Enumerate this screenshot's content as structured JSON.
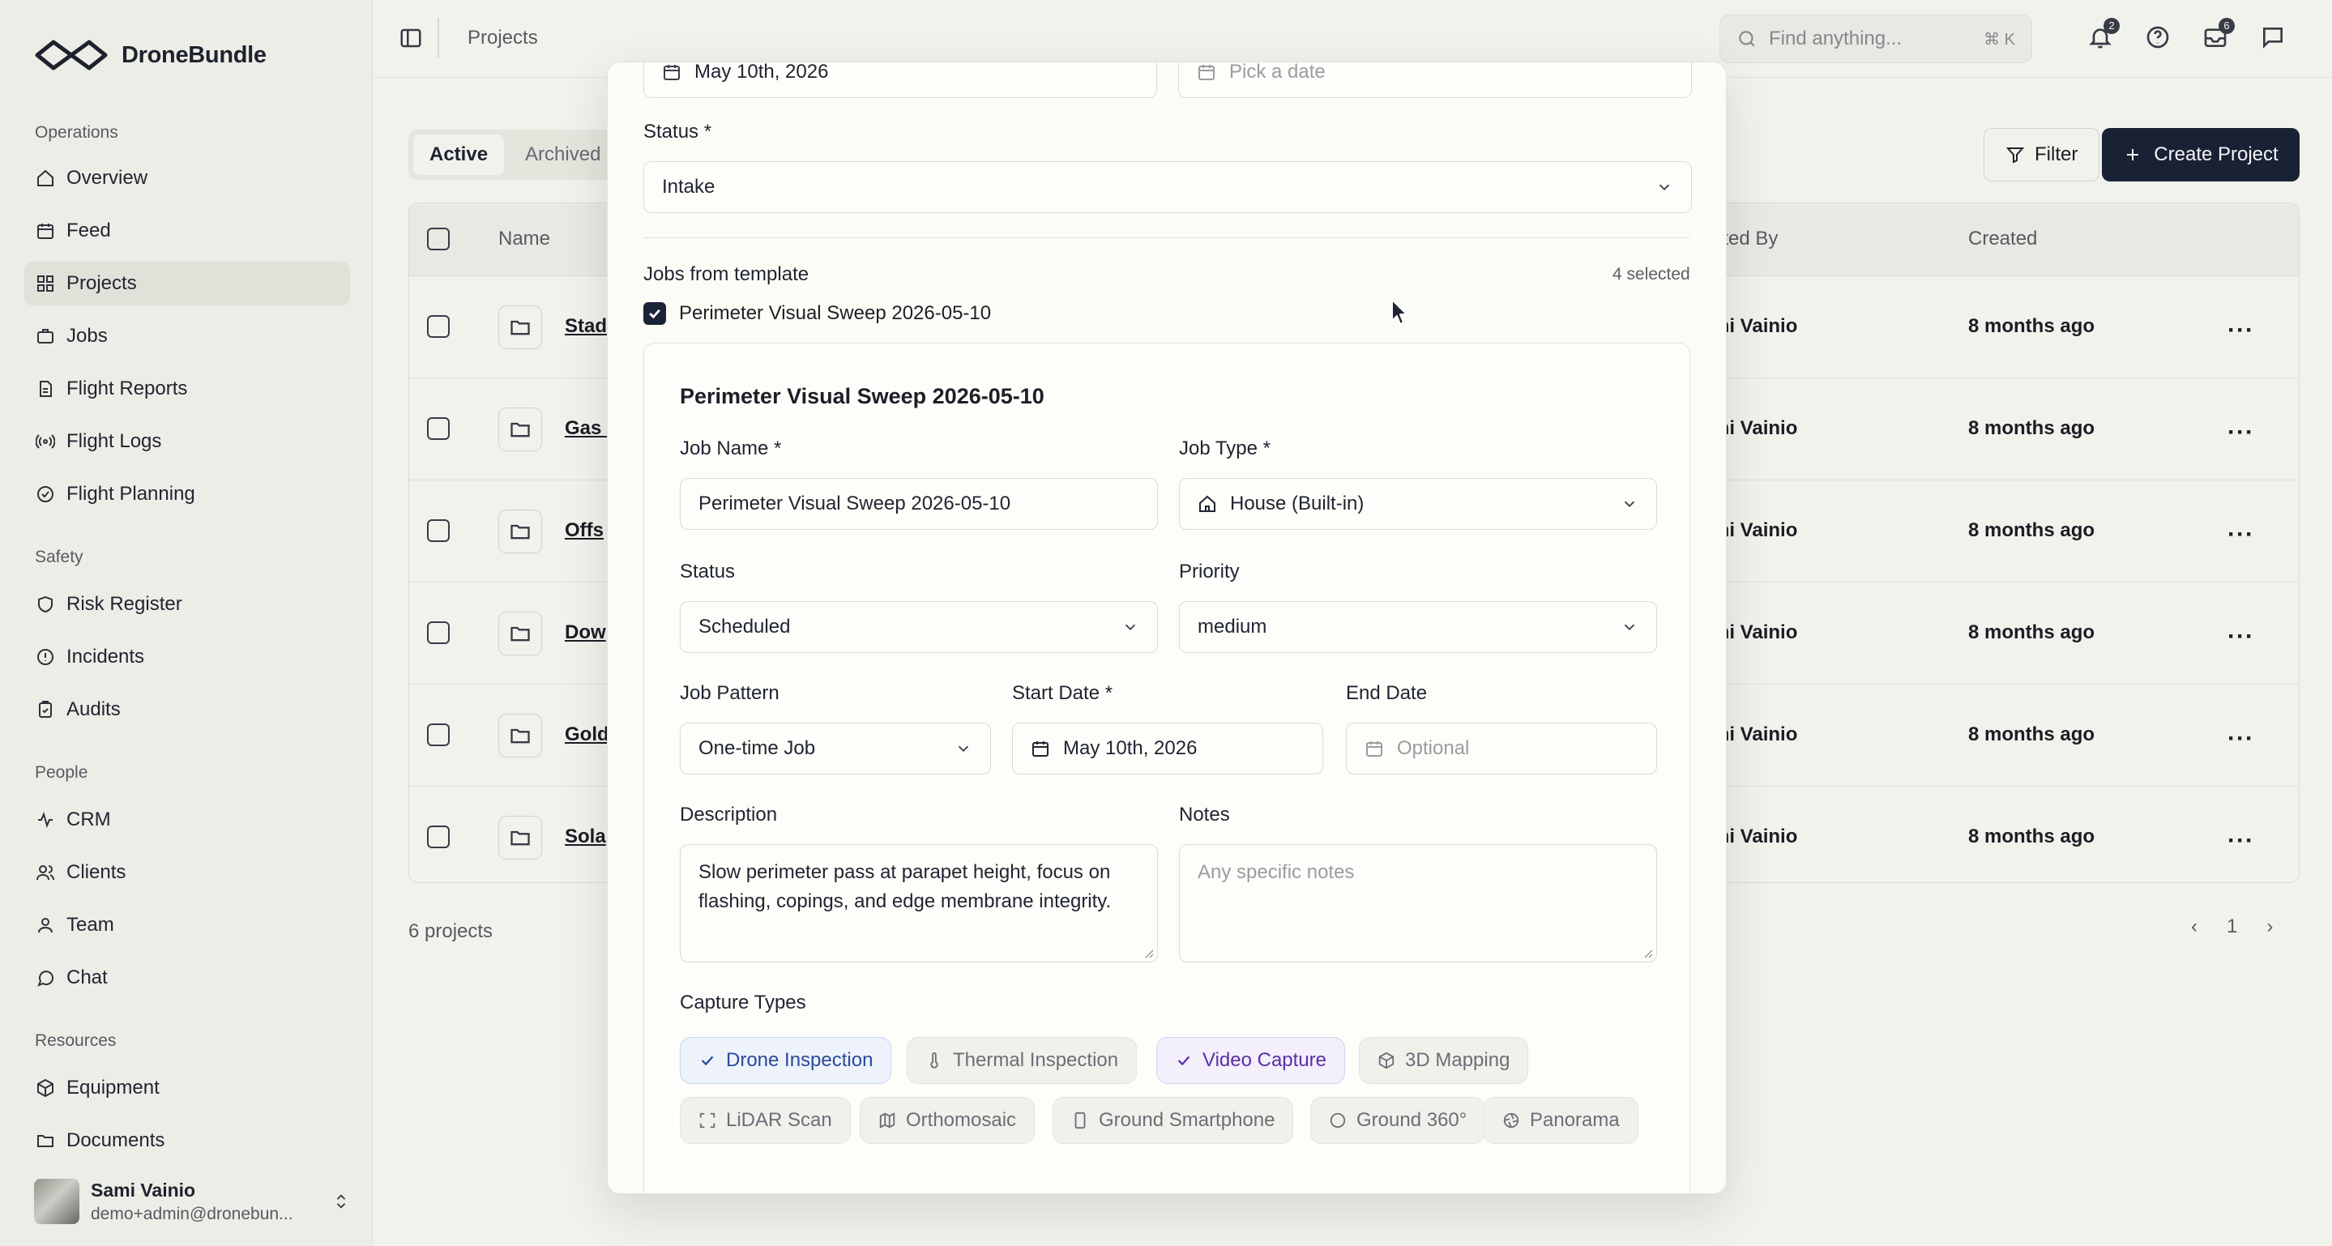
{
  "app": {
    "name": "DroneBundle"
  },
  "sidebar": {
    "sections": [
      {
        "title": "Operations",
        "items": [
          {
            "label": "Overview",
            "icon": "home-icon"
          },
          {
            "label": "Feed",
            "icon": "calendar-icon"
          },
          {
            "label": "Projects",
            "icon": "grid-icon",
            "active": true
          },
          {
            "label": "Jobs",
            "icon": "briefcase-icon"
          },
          {
            "label": "Flight Reports",
            "icon": "file-icon"
          },
          {
            "label": "Flight Logs",
            "icon": "radio-icon"
          },
          {
            "label": "Flight Planning",
            "icon": "check-circle-icon"
          }
        ]
      },
      {
        "title": "Safety",
        "items": [
          {
            "label": "Risk Register",
            "icon": "shield-icon"
          },
          {
            "label": "Incidents",
            "icon": "alert-icon"
          },
          {
            "label": "Audits",
            "icon": "clipboard-icon"
          }
        ]
      },
      {
        "title": "People",
        "items": [
          {
            "label": "CRM",
            "icon": "activity-icon"
          },
          {
            "label": "Clients",
            "icon": "users-icon"
          },
          {
            "label": "Team",
            "icon": "team-icon"
          },
          {
            "label": "Chat",
            "icon": "chat-icon"
          }
        ]
      },
      {
        "title": "Resources",
        "items": [
          {
            "label": "Equipment",
            "icon": "box-icon"
          },
          {
            "label": "Documents",
            "icon": "folder-icon"
          }
        ]
      }
    ],
    "user": {
      "name": "Sami Vainio",
      "email": "demo+admin@dronebun..."
    }
  },
  "topbar": {
    "breadcrumb": "Projects",
    "search_placeholder": "Find anything...",
    "search_shortcut": "⌘ K",
    "notifications_badge": "2",
    "messages_badge": "6"
  },
  "page": {
    "tabs": [
      "Active",
      "Archived"
    ],
    "filter_label": "Filter",
    "create_label": "Create Project",
    "columns": {
      "name": "Name",
      "created_by": "ated By",
      "created": "Created"
    },
    "rows": [
      {
        "name": "Stad",
        "by": "mi Vainio",
        "created": "8 months ago"
      },
      {
        "name": "Gas I",
        "by": "mi Vainio",
        "created": "8 months ago"
      },
      {
        "name": "Offs",
        "by": "mi Vainio",
        "created": "8 months ago"
      },
      {
        "name": "Dow",
        "by": "mi Vainio",
        "created": "8 months ago"
      },
      {
        "name": "Gold",
        "by": "mi Vainio",
        "created": "8 months ago"
      },
      {
        "name": "Sola",
        "by": "mi Vainio",
        "created": "8 months ago"
      }
    ],
    "count": "6 projects",
    "page_number": "1"
  },
  "modal": {
    "start_date": "May 10th, 2026",
    "end_date_placeholder": "Pick a date",
    "status_label": "Status *",
    "status_value": "Intake",
    "jobs_label": "Jobs from template",
    "jobs_selected": "4 selected",
    "job_checkbox_label": "Perimeter Visual Sweep 2026-05-10",
    "job": {
      "title": "Perimeter Visual Sweep 2026-05-10",
      "name_label": "Job Name *",
      "name_value": "Perimeter Visual Sweep 2026-05-10",
      "type_label": "Job Type *",
      "type_value": "House (Built-in)",
      "status_label": "Status",
      "status_value": "Scheduled",
      "priority_label": "Priority",
      "priority_value": "medium",
      "pattern_label": "Job Pattern",
      "pattern_value": "One-time Job",
      "start_label": "Start Date *",
      "start_value": "May 10th, 2026",
      "end_label": "End Date",
      "end_placeholder": "Optional",
      "description_label": "Description",
      "description_value": "Slow perimeter pass at parapet height, focus on flashing, copings, and edge membrane integrity.",
      "notes_label": "Notes",
      "notes_placeholder": "Any specific notes",
      "capture_label": "Capture Types",
      "capture_types": [
        {
          "label": "Drone Inspection",
          "selected": true
        },
        {
          "label": "Thermal Inspection",
          "selected": false
        },
        {
          "label": "Video Capture",
          "selected": true
        },
        {
          "label": "3D Mapping",
          "selected": false
        },
        {
          "label": "LiDAR Scan",
          "selected": false
        },
        {
          "label": "Orthomosaic",
          "selected": false
        },
        {
          "label": "Ground Smartphone",
          "selected": false
        },
        {
          "label": "Ground 360°",
          "selected": false
        },
        {
          "label": "Panorama",
          "selected": false
        }
      ]
    }
  },
  "colors": {
    "primary": "#1b2338",
    "accent_blue": "#2a4a9c",
    "accent_purple": "#5b2fa6",
    "background": "#fcfcf7"
  }
}
